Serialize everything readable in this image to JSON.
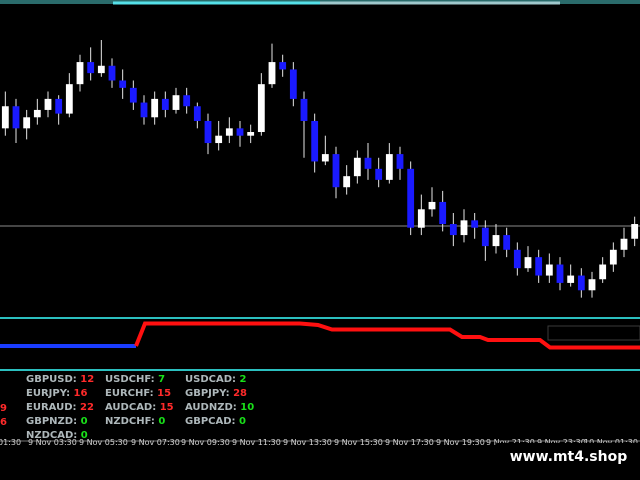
{
  "brand": {
    "text": "www.mt4.shop"
  },
  "colors": {
    "background": "#000000",
    "bull_candle": "#ffffff",
    "bear_candle": "#1a1aff",
    "separator": "#2bbfbf",
    "indicator_blue": "#1a3cff",
    "indicator_red": "#ff1010",
    "value_red": "#ff2a2a",
    "value_green": "#19e019"
  },
  "pairs": [
    {
      "name": "GBPUSD:",
      "value": "12",
      "color": "red"
    },
    {
      "name": "USDCHF:",
      "value": "7",
      "color": "green"
    },
    {
      "name": "USDCAD:",
      "value": "2",
      "color": "green"
    },
    {
      "name": "EURJPY:",
      "value": "16",
      "color": "red"
    },
    {
      "name": "EURCHF:",
      "value": "15",
      "color": "red"
    },
    {
      "name": "GBPJPY:",
      "value": "28",
      "color": "red"
    },
    {
      "name": "EURAUD:",
      "value": "22",
      "color": "red"
    },
    {
      "name": "AUDCAD:",
      "value": "15",
      "color": "red"
    },
    {
      "name": "AUDNZD:",
      "value": "10",
      "color": "green"
    },
    {
      "name": "GBPNZD:",
      "value": "0",
      "color": "green"
    },
    {
      "name": "NZDCHF:",
      "value": "0",
      "color": "green"
    },
    {
      "name": "GBPCAD:",
      "value": "0",
      "color": "green"
    },
    {
      "name": "NZDCAD:",
      "value": "0",
      "color": "green"
    }
  ],
  "side_values": [
    "9",
    "6"
  ],
  "time_labels": [
    "01:30",
    "9 Nov 03:30",
    "9 Nov 05:30",
    "9 Nov 07:30",
    "9 Nov 09:30",
    "9 Nov 11:30",
    "9 Nov 13:30",
    "9 Nov 15:30",
    "9 Nov 17:30",
    "9 Nov 19:30",
    "9 Nov 21:30",
    "9 Nov 23:30",
    "10 Nov 01:30"
  ],
  "indicator": {
    "blue_values": [
      0.2,
      0.2,
      0.2,
      0.2,
      0.2
    ],
    "red_values": [
      0.2,
      0.95,
      0.95,
      0.95,
      0.95,
      0.95,
      0.9,
      0.75,
      0.75,
      0.75,
      0.75,
      0.5,
      0.5,
      0.4,
      0.4,
      0.15,
      0.15
    ]
  },
  "candles": [
    {
      "o": 1.338,
      "c": 1.344,
      "h": 1.348,
      "l": 1.336
    },
    {
      "o": 1.344,
      "c": 1.338,
      "h": 1.346,
      "l": 1.334
    },
    {
      "o": 1.338,
      "c": 1.341,
      "h": 1.343,
      "l": 1.335
    },
    {
      "o": 1.341,
      "c": 1.343,
      "h": 1.346,
      "l": 1.339
    },
    {
      "o": 1.343,
      "c": 1.346,
      "h": 1.348,
      "l": 1.341
    },
    {
      "o": 1.346,
      "c": 1.342,
      "h": 1.347,
      "l": 1.339
    },
    {
      "o": 1.342,
      "c": 1.35,
      "h": 1.353,
      "l": 1.341
    },
    {
      "o": 1.35,
      "c": 1.356,
      "h": 1.358,
      "l": 1.348
    },
    {
      "o": 1.356,
      "c": 1.353,
      "h": 1.36,
      "l": 1.351
    },
    {
      "o": 1.353,
      "c": 1.355,
      "h": 1.362,
      "l": 1.352
    },
    {
      "o": 1.355,
      "c": 1.351,
      "h": 1.357,
      "l": 1.349
    },
    {
      "o": 1.351,
      "c": 1.349,
      "h": 1.354,
      "l": 1.346
    },
    {
      "o": 1.349,
      "c": 1.345,
      "h": 1.351,
      "l": 1.343
    },
    {
      "o": 1.345,
      "c": 1.341,
      "h": 1.347,
      "l": 1.339
    },
    {
      "o": 1.341,
      "c": 1.346,
      "h": 1.348,
      "l": 1.339
    },
    {
      "o": 1.346,
      "c": 1.343,
      "h": 1.348,
      "l": 1.341
    },
    {
      "o": 1.343,
      "c": 1.347,
      "h": 1.349,
      "l": 1.342
    },
    {
      "o": 1.347,
      "c": 1.344,
      "h": 1.349,
      "l": 1.342
    },
    {
      "o": 1.344,
      "c": 1.34,
      "h": 1.345,
      "l": 1.338
    },
    {
      "o": 1.34,
      "c": 1.334,
      "h": 1.342,
      "l": 1.331
    },
    {
      "o": 1.334,
      "c": 1.336,
      "h": 1.34,
      "l": 1.332
    },
    {
      "o": 1.336,
      "c": 1.338,
      "h": 1.341,
      "l": 1.334
    },
    {
      "o": 1.338,
      "c": 1.336,
      "h": 1.34,
      "l": 1.333
    },
    {
      "o": 1.336,
      "c": 1.337,
      "h": 1.339,
      "l": 1.334
    },
    {
      "o": 1.337,
      "c": 1.35,
      "h": 1.353,
      "l": 1.336
    },
    {
      "o": 1.35,
      "c": 1.356,
      "h": 1.361,
      "l": 1.349
    },
    {
      "o": 1.356,
      "c": 1.354,
      "h": 1.358,
      "l": 1.352
    },
    {
      "o": 1.354,
      "c": 1.346,
      "h": 1.356,
      "l": 1.344
    },
    {
      "o": 1.346,
      "c": 1.34,
      "h": 1.348,
      "l": 1.33
    },
    {
      "o": 1.34,
      "c": 1.329,
      "h": 1.342,
      "l": 1.326
    },
    {
      "o": 1.329,
      "c": 1.331,
      "h": 1.336,
      "l": 1.328
    },
    {
      "o": 1.331,
      "c": 1.322,
      "h": 1.333,
      "l": 1.319
    },
    {
      "o": 1.322,
      "c": 1.325,
      "h": 1.328,
      "l": 1.32
    },
    {
      "o": 1.325,
      "c": 1.33,
      "h": 1.332,
      "l": 1.323
    },
    {
      "o": 1.33,
      "c": 1.327,
      "h": 1.334,
      "l": 1.324
    },
    {
      "o": 1.327,
      "c": 1.324,
      "h": 1.33,
      "l": 1.322
    },
    {
      "o": 1.324,
      "c": 1.331,
      "h": 1.334,
      "l": 1.323
    },
    {
      "o": 1.331,
      "c": 1.327,
      "h": 1.333,
      "l": 1.324
    },
    {
      "o": 1.327,
      "c": 1.311,
      "h": 1.329,
      "l": 1.309
    },
    {
      "o": 1.311,
      "c": 1.316,
      "h": 1.32,
      "l": 1.309
    },
    {
      "o": 1.316,
      "c": 1.318,
      "h": 1.322,
      "l": 1.314
    },
    {
      "o": 1.318,
      "c": 1.312,
      "h": 1.321,
      "l": 1.31
    },
    {
      "o": 1.312,
      "c": 1.309,
      "h": 1.315,
      "l": 1.306
    },
    {
      "o": 1.309,
      "c": 1.313,
      "h": 1.316,
      "l": 1.307
    },
    {
      "o": 1.313,
      "c": 1.311,
      "h": 1.315,
      "l": 1.308
    },
    {
      "o": 1.311,
      "c": 1.306,
      "h": 1.313,
      "l": 1.302
    },
    {
      "o": 1.306,
      "c": 1.309,
      "h": 1.312,
      "l": 1.304
    },
    {
      "o": 1.309,
      "c": 1.305,
      "h": 1.311,
      "l": 1.303
    },
    {
      "o": 1.305,
      "c": 1.3,
      "h": 1.307,
      "l": 1.298
    },
    {
      "o": 1.3,
      "c": 1.303,
      "h": 1.306,
      "l": 1.299
    },
    {
      "o": 1.303,
      "c": 1.298,
      "h": 1.305,
      "l": 1.296
    },
    {
      "o": 1.298,
      "c": 1.301,
      "h": 1.304,
      "l": 1.296
    },
    {
      "o": 1.301,
      "c": 1.296,
      "h": 1.303,
      "l": 1.294
    },
    {
      "o": 1.296,
      "c": 1.298,
      "h": 1.301,
      "l": 1.295
    },
    {
      "o": 1.298,
      "c": 1.294,
      "h": 1.3,
      "l": 1.292
    },
    {
      "o": 1.294,
      "c": 1.297,
      "h": 1.299,
      "l": 1.292
    },
    {
      "o": 1.297,
      "c": 1.301,
      "h": 1.303,
      "l": 1.296
    },
    {
      "o": 1.301,
      "c": 1.305,
      "h": 1.307,
      "l": 1.299
    },
    {
      "o": 1.305,
      "c": 1.308,
      "h": 1.311,
      "l": 1.303
    },
    {
      "o": 1.308,
      "c": 1.312,
      "h": 1.314,
      "l": 1.306
    }
  ]
}
